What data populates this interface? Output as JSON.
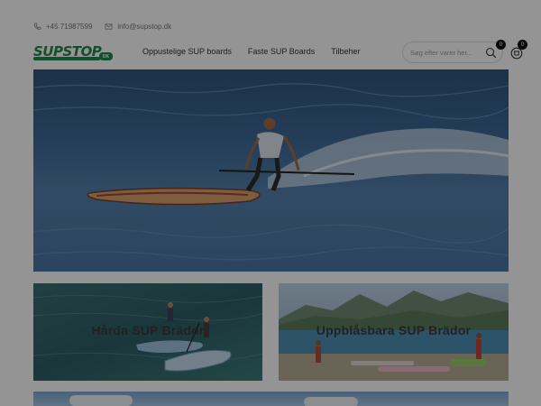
{
  "topbar": {
    "phone": "+45 71987599",
    "email": "info@supstop.dk",
    "phone_icon": "phone-icon",
    "email_icon": "mail-icon"
  },
  "header": {
    "logo_text": "SUPSTOP",
    "logo_badge": "DK",
    "nav": [
      {
        "label": "Oppustelige SUP boards"
      },
      {
        "label": "Faste SUP Boards"
      },
      {
        "label": "Tilbeher"
      }
    ],
    "search_placeholder": "Søg efter varer her...",
    "search_icon": "search-icon",
    "wishlist_count": "0",
    "cart_count": "0",
    "cart_icon": "cart-icon"
  },
  "hero": {
    "image_icon": "surfer-image"
  },
  "categories": [
    {
      "title": "Hårda SUP Brädor"
    },
    {
      "title": "Uppblåsbara SUP Brädor"
    }
  ],
  "colors": {
    "brand": "#1f8a4c",
    "overlay": "rgba(0,0,0,0.42)",
    "water": "#3f6a98"
  }
}
